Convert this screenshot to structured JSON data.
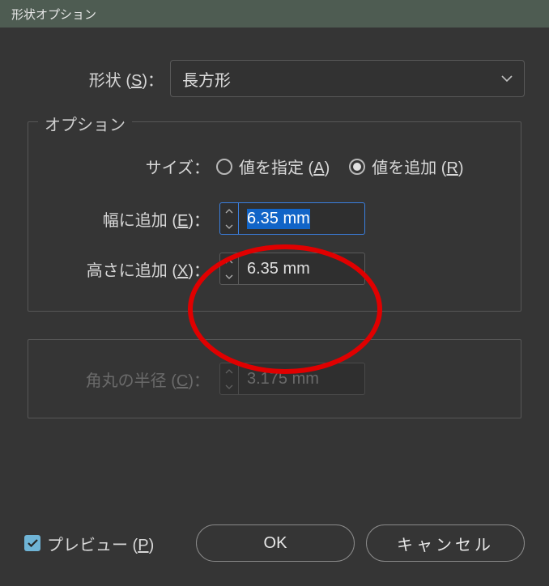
{
  "titlebar": {
    "title": "形状オプション"
  },
  "shape": {
    "label_prefix": "形状 (",
    "label_mnemonic": "S",
    "label_suffix": ")：",
    "value": "長方形"
  },
  "options": {
    "legend": "オプション",
    "size_label": "サイズ：",
    "radio_specify": {
      "prefix": "値を指定 (",
      "mnemonic": "A",
      "suffix": ")",
      "checked": false
    },
    "radio_append": {
      "prefix": "値を追加 (",
      "mnemonic": "R",
      "suffix": ")",
      "checked": true
    },
    "width": {
      "label_prefix": "幅に追加 (",
      "label_mnemonic": "E",
      "label_suffix": ")：",
      "value": "6.35 mm",
      "selected": true
    },
    "height": {
      "label_prefix": "高さに追加 (",
      "label_mnemonic": "X",
      "label_suffix": ")：",
      "value": "6.35 mm",
      "selected": false
    }
  },
  "corner": {
    "label_prefix": "角丸の半径 (",
    "label_mnemonic": "C",
    "label_suffix": ")：",
    "value": "3.175 mm",
    "enabled": false
  },
  "footer": {
    "preview_prefix": "プレビュー (",
    "preview_mnemonic": "P",
    "preview_suffix": ")",
    "preview_checked": true,
    "ok": "OK",
    "cancel": "キャンセル"
  },
  "colors": {
    "accent": "#6fb4d6",
    "selection": "#1164c7",
    "annotation": "#e00000"
  }
}
